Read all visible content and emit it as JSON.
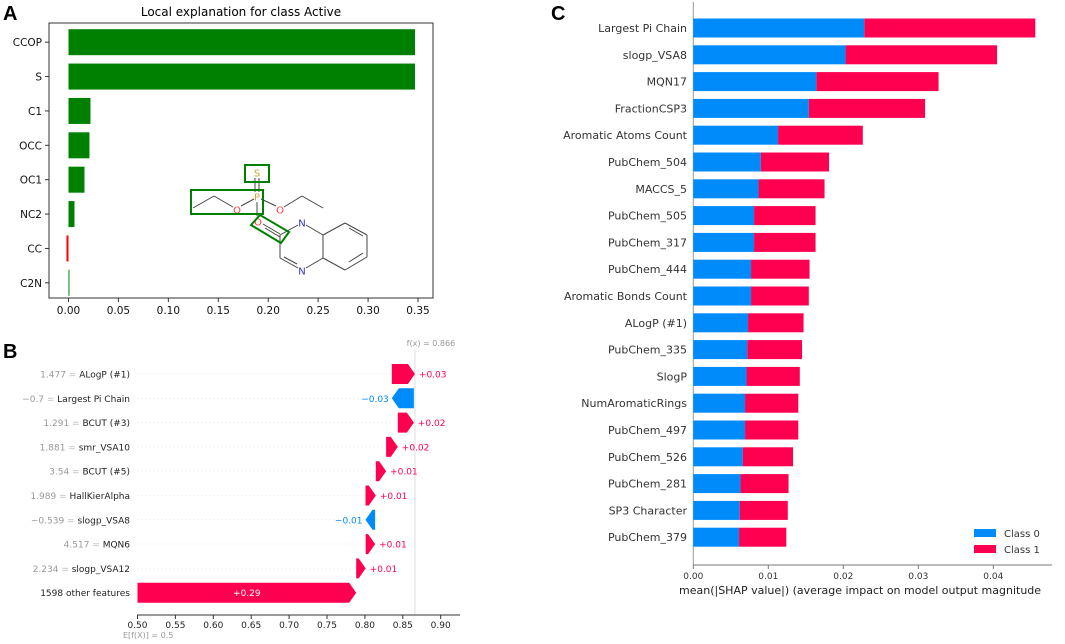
{
  "panels": {
    "a": "A",
    "b": "B",
    "c": "C"
  },
  "colors": {
    "green": "#008000",
    "red": "#ff0000",
    "shap_pos": "#ff0051",
    "shap_neg": "#008bfb",
    "class0": "#008bfb",
    "class1": "#ff0051"
  },
  "molecule": {
    "atom_labels": {
      "s": "S",
      "p": "P",
      "o_left": "O",
      "o_right": "O",
      "o_bottom": "O",
      "n_top": "N",
      "n_bottom": "N"
    }
  },
  "chart_data": [
    {
      "type": "bar",
      "orientation": "horizontal",
      "title": "Local explanation for class Active",
      "categories": [
        "CCOP",
        "S",
        "C1",
        "OCC",
        "OC1",
        "NC2",
        "CC",
        "C2N"
      ],
      "values": [
        0.347,
        0.347,
        0.022,
        0.021,
        0.016,
        0.006,
        -0.002,
        0.001
      ],
      "xlim": [
        -0.02,
        0.36
      ],
      "xticks": [
        "0.00",
        "0.05",
        "0.10",
        "0.15",
        "0.20",
        "0.25",
        "0.30",
        "0.35"
      ],
      "xtick_values": [
        0,
        0.05,
        0.1,
        0.15,
        0.2,
        0.25,
        0.3,
        0.35
      ],
      "grid": false
    },
    {
      "type": "waterfall",
      "base_label": "E[f(X)] = 0.5",
      "base_value": 0.5,
      "output_label": "f(x) = 0.866",
      "output_value": 0.866,
      "features": [
        {
          "value": "1.477",
          "name": "ALogP (#1)",
          "contribution": 0.0305,
          "label": "+0.03"
        },
        {
          "value": "−0.7",
          "name": "Largest Pi Chain",
          "contribution": -0.0291,
          "label": "−0.03"
        },
        {
          "value": "1.291",
          "name": "BCUT (#3)",
          "contribution": 0.0212,
          "label": "+0.02"
        },
        {
          "value": "1.881",
          "name": "smr_VSA10",
          "contribution": 0.0154,
          "label": "+0.02"
        },
        {
          "value": "3.54",
          "name": "BCUT (#5)",
          "contribution": 0.0136,
          "label": "+0.01"
        },
        {
          "value": "1.989",
          "name": "HallKierAlpha",
          "contribution": 0.0136,
          "label": "+0.01"
        },
        {
          "value": "−0.539",
          "name": "slogp_VSA8",
          "contribution": -0.0127,
          "label": "−0.01"
        },
        {
          "value": "4.517",
          "name": "MQN6",
          "contribution": 0.0125,
          "label": "+0.01"
        },
        {
          "value": "2.234",
          "name": "slogp_VSA12",
          "contribution": 0.0125,
          "label": "+0.01"
        },
        {
          "value": "",
          "name": "1598 other features",
          "contribution": 0.2885,
          "label": "+0.29"
        }
      ],
      "xlim": [
        0.5,
        0.92
      ],
      "xticks": [
        "0.50",
        "0.55",
        "0.60",
        "0.65",
        "0.70",
        "0.75",
        "0.80",
        "0.85",
        "0.90"
      ],
      "xtick_values": [
        0.5,
        0.55,
        0.6,
        0.65,
        0.7,
        0.75,
        0.8,
        0.85,
        0.9
      ]
    },
    {
      "type": "bar",
      "orientation": "horizontal",
      "stacked": true,
      "xlabel": "mean(|SHAP value|) (average impact on model output magnitude",
      "categories": [
        "Largest Pi Chain",
        "slogp_VSA8",
        "MQN17",
        "FractionCSP3",
        "Aromatic Atoms Count",
        "PubChem_504",
        "MACCS_5",
        "PubChem_505",
        "PubChem_317",
        "PubChem_444",
        "Aromatic Bonds Count",
        "ALogP (#1)",
        "PubChem_335",
        "SlogP",
        "NumAromaticRings",
        "PubChem_497",
        "PubChem_526",
        "PubChem_281",
        "SP3 Character",
        "PubChem_379"
      ],
      "series": [
        {
          "name": "Class 0",
          "values": [
            0.0228,
            0.0203,
            0.0164,
            0.0154,
            0.0113,
            0.009,
            0.0087,
            0.0081,
            0.0081,
            0.0077,
            0.0077,
            0.0073,
            0.0072,
            0.0071,
            0.0069,
            0.0069,
            0.0066,
            0.0063,
            0.0062,
            0.0061
          ]
        },
        {
          "name": "Class 1",
          "values": [
            0.0228,
            0.0202,
            0.0163,
            0.0155,
            0.0113,
            0.0091,
            0.0088,
            0.0082,
            0.0082,
            0.0078,
            0.0077,
            0.0074,
            0.0073,
            0.0071,
            0.0071,
            0.0071,
            0.0067,
            0.0064,
            0.0064,
            0.0063
          ]
        }
      ],
      "xlim": [
        0,
        0.0478
      ],
      "xticks": [
        "0.00",
        "0.01",
        "0.02",
        "0.03",
        "0.04"
      ],
      "xtick_values": [
        0,
        0.01,
        0.02,
        0.03,
        0.04
      ],
      "legend": "bottom-right"
    }
  ]
}
